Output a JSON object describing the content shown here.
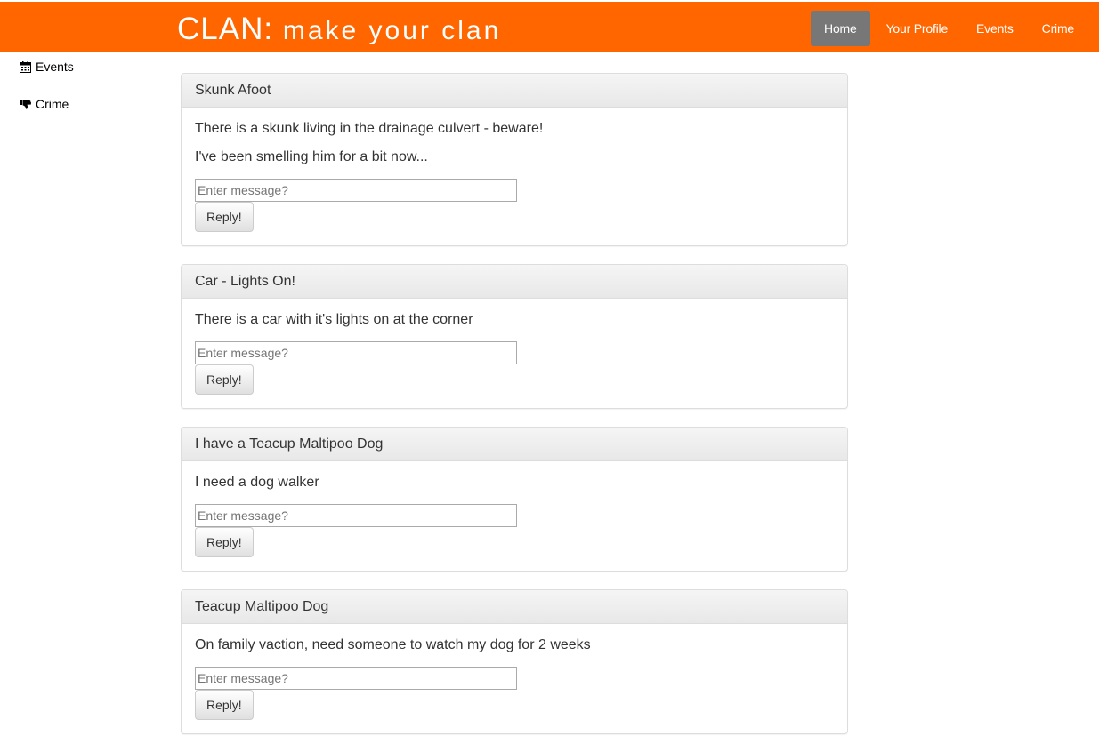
{
  "header": {
    "brand_main": "CLAN:",
    "brand_rest": "make your clan",
    "nav": [
      {
        "label": "Home",
        "active": true
      },
      {
        "label": "Your Profile",
        "active": false
      },
      {
        "label": "Events",
        "active": false
      },
      {
        "label": "Crime",
        "active": false
      }
    ],
    "bar_color": "#ff6600"
  },
  "sidebar": {
    "items": [
      {
        "label": "Events",
        "icon": "calendar-icon"
      },
      {
        "label": "Crime",
        "icon": "thumbs-down-icon"
      }
    ]
  },
  "reply": {
    "placeholder": "Enter message?",
    "button_label": "Reply!"
  },
  "posts": [
    {
      "title": "Skunk Afoot",
      "messages": [
        "There is a skunk living in the drainage culvert - beware!",
        "I've been smelling him for a bit now..."
      ]
    },
    {
      "title": "Car - Lights On!",
      "messages": [
        "There is a car with it's lights on at the corner"
      ]
    },
    {
      "title": "I have a Teacup Maltipoo Dog",
      "messages": [
        "I need a dog walker"
      ]
    },
    {
      "title": "Teacup Maltipoo Dog",
      "messages": [
        "On family vaction, need someone to watch my dog for 2 weeks"
      ]
    }
  ]
}
